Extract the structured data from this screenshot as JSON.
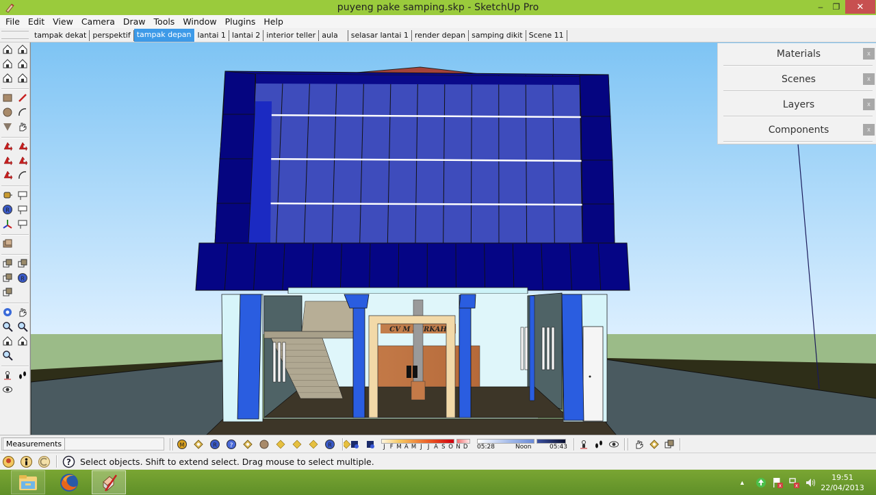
{
  "window": {
    "title": "puyeng pake samping.skp - SketchUp Pro",
    "controls": {
      "minimize": "–",
      "maximize": "❐",
      "close": "✕"
    }
  },
  "menu": [
    "File",
    "Edit",
    "View",
    "Camera",
    "Draw",
    "Tools",
    "Window",
    "Plugins",
    "Help"
  ],
  "scene_tabs": {
    "active": "tampak depan",
    "items": [
      "tampak dekat",
      "perspektif",
      "tampak depan",
      "lantai 1",
      "lantai 2",
      "interior teller",
      "aula",
      "selasar lantai 1",
      "render depan",
      "samping dikit",
      "Scene 11"
    ]
  },
  "left_toolbar": {
    "groups": [
      [
        "iso-view-icon",
        "front-view-icon",
        "top-view-icon",
        "right-view-icon",
        "back-view-icon",
        "left-view-icon"
      ],
      [
        "rectangle-icon",
        "pencil-line-icon",
        "circle-icon",
        "arc-icon",
        "polygon-icon",
        "freehand-icon"
      ],
      [
        "move-icon",
        "push-pull-icon",
        "rotate-icon",
        "follow-me-icon",
        "scale-icon",
        "offset-icon"
      ],
      [
        "tape-measure-icon",
        "dimension-icon",
        "protractor-icon",
        "text-icon",
        "axes-icon",
        "3d-text-icon"
      ],
      [
        "section-plane-icon"
      ],
      [
        "union-icon",
        "subtract-icon",
        "intersect-icon",
        "trim-icon",
        "split-icon"
      ],
      [
        "orbit-icon",
        "pan-icon",
        "zoom-icon",
        "zoom-window-icon",
        "previous-view-icon",
        "next-view-icon",
        "zoom-extents-icon"
      ],
      [
        "position-camera-icon",
        "walk-icon",
        "look-around-icon"
      ]
    ]
  },
  "tray": {
    "panels": [
      {
        "title": "Materials",
        "close": "x"
      },
      {
        "title": "Scenes",
        "close": "x"
      },
      {
        "title": "Layers",
        "close": "x"
      },
      {
        "title": "Components",
        "close": "x"
      }
    ]
  },
  "measurements": {
    "label": "Measurements",
    "value": ""
  },
  "bottom_toolbar": {
    "sandbox_tools": [
      "m-icon",
      "tag-icon",
      "r-icon",
      "help-icon",
      "lock-tag-icon",
      "sphere-icon",
      "lamp-icon",
      "flag-icon",
      "spot-icon",
      "gem-icon",
      "bug-icon"
    ],
    "shadow_tools": [
      "shadow-settings-icon",
      "display-shadows-icon"
    ],
    "shadow_months": [
      "J",
      "F",
      "M",
      "A",
      "M",
      "J",
      "J",
      "A",
      "S",
      "O",
      "N",
      "D"
    ],
    "shadow_time": {
      "start": "05:28",
      "mid": "Noon",
      "end": "05:43"
    },
    "walkthrough_tools": [
      "position-camera-icon",
      "walk-icon",
      "look-around-icon"
    ],
    "extra_tools": [
      "hand-icon",
      "component-tag-icon",
      "component-browse-icon"
    ]
  },
  "statusbar": {
    "icons": [
      "geo-location-icon",
      "credits-icon",
      "sign-in-icon",
      "help-icon"
    ],
    "message": "Select objects. Shift to extend select. Drag mouse to select multiple."
  },
  "taskbar": {
    "apps": [
      {
        "name": "File Explorer",
        "icon": "folder-icon"
      },
      {
        "name": "Firefox",
        "icon": "firefox-icon"
      },
      {
        "name": "SketchUp",
        "icon": "sketchup-icon",
        "active": true
      }
    ],
    "tray_icons": [
      "show-hidden-icon",
      "sync-icon",
      "action-center-flag-icon",
      "network-icon",
      "volume-icon"
    ],
    "time": "19:51",
    "date": "22/04/2013"
  },
  "model": {
    "signage_text": "CV M BERKAH"
  }
}
